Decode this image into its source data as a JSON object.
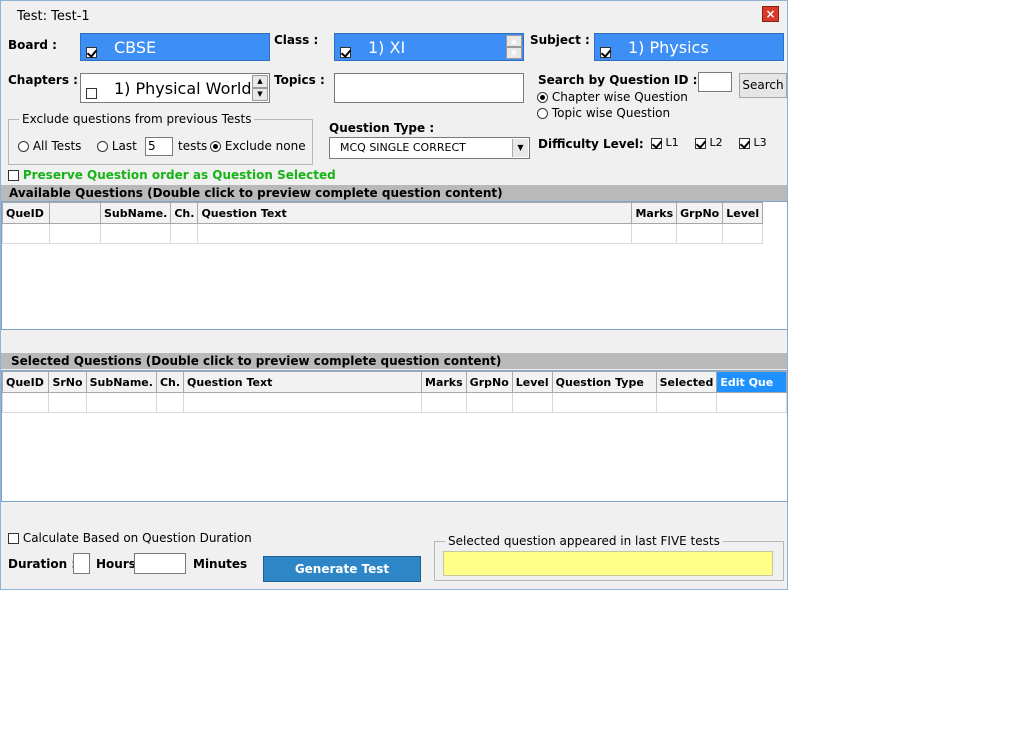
{
  "window": {
    "title": "Test: Test-1",
    "close_label": "×"
  },
  "board": {
    "label": "Board :",
    "value": "CBSE"
  },
  "class": {
    "label": "Class :",
    "value": "1) XI"
  },
  "subject": {
    "label": "Subject :",
    "value": "1) Physics"
  },
  "chapters": {
    "label": "Chapters :",
    "value": "1) Physical World"
  },
  "topics": {
    "label": "Topics :",
    "value": ""
  },
  "search_id": {
    "label": "Search by Question ID :",
    "value": "",
    "button": "Search"
  },
  "search_mode": {
    "chapter_wise": "Chapter wise Question",
    "topic_wise": "Topic wise Question",
    "selected": "chapter_wise"
  },
  "exclude": {
    "legend": "Exclude questions from previous Tests",
    "all_tests": "All Tests",
    "last": "Last",
    "last_value": "5",
    "tests": "tests",
    "exclude_none": "Exclude none",
    "selected": "exclude_none"
  },
  "question_type": {
    "label": "Question Type :",
    "value": "MCQ SINGLE CORRECT"
  },
  "difficulty": {
    "label": "Difficulty Level:",
    "levels": [
      {
        "name": "L1",
        "checked": true
      },
      {
        "name": "L2",
        "checked": true
      },
      {
        "name": "L3",
        "checked": true
      }
    ]
  },
  "preserve_order": {
    "label": "Preserve Question order as Question Selected",
    "checked": false,
    "color": "#17b317"
  },
  "available": {
    "header": "Available Questions (Double click to preview complete question content)",
    "columns": [
      "QueID",
      "",
      "SubName.",
      "Ch.",
      "Question Text",
      "Marks",
      "GrpNo",
      "Level"
    ]
  },
  "selected": {
    "header": "Selected Questions (Double click to preview complete question content)",
    "columns": [
      "QueID",
      "SrNo",
      "SubName.",
      "Ch.",
      "Question Text",
      "Marks",
      "GrpNo",
      "Level",
      "Question Type",
      "Selected",
      "Edit Que"
    ],
    "highlight_column": "Edit Que"
  },
  "footer": {
    "calc_label": "Calculate Based on Question Duration",
    "calc_checked": false,
    "duration_label": "Duration :",
    "hours_label": "Hours",
    "minutes_label": "Minutes",
    "hours_value": "",
    "minutes_value": "",
    "generate_button": "Generate Test",
    "appeared_legend": "Selected question appeared in last FIVE tests",
    "appeared_value": ""
  },
  "colors": {
    "accent": "#3d8ef5",
    "header_bar": "#b9b9b9",
    "yellow_box": "#ffff88",
    "button_blue": "#2e86c7"
  }
}
